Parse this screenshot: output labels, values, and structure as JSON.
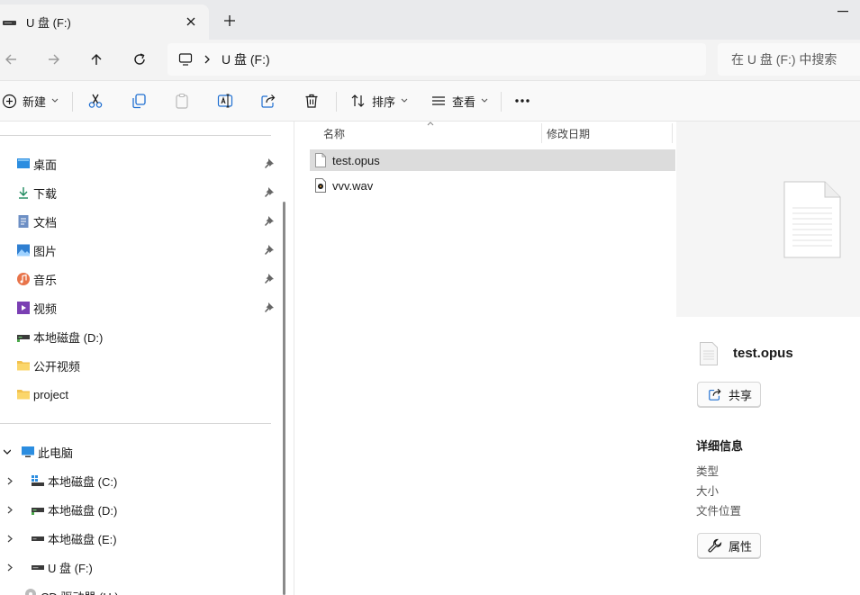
{
  "tab": {
    "title": "U 盘 (F:)"
  },
  "address": {
    "crumb": "U 盘 (F:)"
  },
  "search": {
    "placeholder": "在 U 盘 (F:) 中搜索"
  },
  "toolbar": {
    "new_label": "新建",
    "sort_label": "排序",
    "view_label": "查看"
  },
  "sidebar": {
    "quick_access": [
      {
        "label": "桌面",
        "icon": "desktop-icon",
        "pinned": true
      },
      {
        "label": "下载",
        "icon": "download-icon",
        "pinned": true
      },
      {
        "label": "文档",
        "icon": "document-icon",
        "pinned": true
      },
      {
        "label": "图片",
        "icon": "picture-icon",
        "pinned": true
      },
      {
        "label": "音乐",
        "icon": "music-icon",
        "pinned": true
      },
      {
        "label": "视频",
        "icon": "video-icon",
        "pinned": true
      },
      {
        "label": "本地磁盘 (D:)",
        "icon": "drive-icon",
        "pinned": false
      },
      {
        "label": "公开视频",
        "icon": "folder-icon",
        "pinned": false
      },
      {
        "label": "project",
        "icon": "folder-icon",
        "pinned": false
      }
    ],
    "this_pc": {
      "label": "此电脑"
    },
    "drives": [
      {
        "label": "本地磁盘 (C:)",
        "icon": "windows-drive-icon"
      },
      {
        "label": "本地磁盘 (D:)",
        "icon": "drive-icon"
      },
      {
        "label": "本地磁盘 (E:)",
        "icon": "drive-icon"
      },
      {
        "label": "U 盘 (F:)",
        "icon": "usb-drive-icon"
      },
      {
        "label": "CD 驱动器 (H:)",
        "icon": "cd-drive-icon"
      }
    ]
  },
  "filelist": {
    "columns": {
      "name": "名称",
      "modified": "修改日期"
    },
    "files": [
      {
        "name": "test.opus",
        "icon": "file-icon",
        "selected": true
      },
      {
        "name": "vvv.wav",
        "icon": "audio-file-icon",
        "selected": false
      }
    ]
  },
  "details": {
    "file_name": "test.opus",
    "share_label": "共享",
    "section_title": "详细信息",
    "fields": {
      "type": "类型",
      "size": "大小",
      "location": "文件位置"
    },
    "properties_label": "属性"
  },
  "colors": {
    "accent": "#0067c0",
    "selected_row": "#dcdcdc",
    "chrome": "#f3f3f3"
  }
}
